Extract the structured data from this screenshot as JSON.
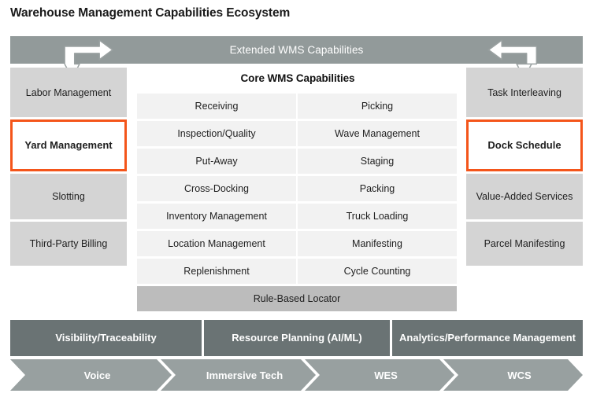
{
  "title": "Warehouse Management Capabilities Ecosystem",
  "colors": {
    "extended_band": "#929a9a",
    "side_box": "#d4d4d4",
    "highlight_border": "#f4551a",
    "core_cell": "#f2f2f2",
    "core_full_cell": "#bcbcbc",
    "layer_band": "#6a7374",
    "chevron": "#98a0a0",
    "text_dark": "#1f1f1f",
    "text_light": "#ffffff"
  },
  "extended_band": {
    "label": "Extended WMS Capabilities",
    "left_arrow_icon": "arrow-hook-right-down-icon",
    "right_arrow_icon": "arrow-hook-left-down-icon"
  },
  "left_column": {
    "items": [
      {
        "label": "Labor Management",
        "highlight": false
      },
      {
        "label": "Yard Management",
        "highlight": true
      },
      {
        "label": "Slotting",
        "highlight": false
      },
      {
        "label": "Third-Party Billing",
        "highlight": false
      }
    ]
  },
  "right_column": {
    "items": [
      {
        "label": "Task Interleaving",
        "highlight": false
      },
      {
        "label": "Dock Schedule",
        "highlight": true
      },
      {
        "label": "Value-Added Services",
        "highlight": false
      },
      {
        "label": "Parcel Manifesting",
        "highlight": false
      }
    ]
  },
  "core_panel": {
    "title": "Core WMS Capabilities",
    "cells": [
      "Receiving",
      "Picking",
      "Inspection/Quality",
      "Wave Management",
      "Put-Away",
      "Staging",
      "Cross-Docking",
      "Packing",
      "Inventory Management",
      "Truck Loading",
      "Location Management",
      "Manifesting",
      "Replenishment",
      "Cycle Counting"
    ],
    "full_width_cell": "Rule-Based Locator"
  },
  "layer_row": {
    "items": [
      "Visibility/Traceability",
      "Resource Planning (AI/ML)",
      "Analytics/Performance Management"
    ]
  },
  "chevron_row": {
    "items": [
      "Voice",
      "Immersive Tech",
      "WES",
      "WCS"
    ]
  }
}
